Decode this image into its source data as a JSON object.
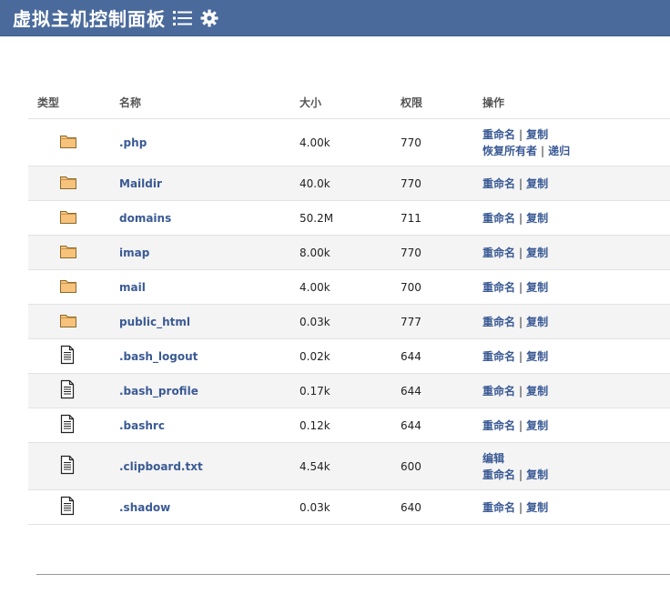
{
  "header": {
    "title": "虚拟主机控制面板",
    "menu_icon": "list-menu-icon",
    "settings_icon": "gear-icon",
    "bg_color": "#4a6a9c"
  },
  "table": {
    "columns": [
      "类型",
      "名称",
      "大小",
      "权限",
      "操作"
    ],
    "rows": [
      {
        "type": "folder",
        "name": ".php",
        "size": "4.00k",
        "perm": "770",
        "actions": [
          [
            "重命名",
            "复制"
          ],
          [
            "恢复所有者",
            "递归"
          ]
        ]
      },
      {
        "type": "folder",
        "name": "Maildir",
        "size": "40.0k",
        "perm": "770",
        "actions": [
          [
            "重命名",
            "复制"
          ]
        ]
      },
      {
        "type": "folder",
        "name": "domains",
        "size": "50.2M",
        "perm": "711",
        "actions": [
          [
            "重命名",
            "复制"
          ]
        ]
      },
      {
        "type": "folder",
        "name": "imap",
        "size": "8.00k",
        "perm": "770",
        "actions": [
          [
            "重命名",
            "复制"
          ]
        ]
      },
      {
        "type": "folder",
        "name": "mail",
        "size": "4.00k",
        "perm": "700",
        "actions": [
          [
            "重命名",
            "复制"
          ]
        ]
      },
      {
        "type": "folder",
        "name": "public_html",
        "size": "0.03k",
        "perm": "777",
        "actions": [
          [
            "重命名",
            "复制"
          ]
        ]
      },
      {
        "type": "file",
        "name": ".bash_logout",
        "size": "0.02k",
        "perm": "644",
        "actions": [
          [
            "重命名",
            "复制"
          ]
        ]
      },
      {
        "type": "file",
        "name": ".bash_profile",
        "size": "0.17k",
        "perm": "644",
        "actions": [
          [
            "重命名",
            "复制"
          ]
        ]
      },
      {
        "type": "file",
        "name": ".bashrc",
        "size": "0.12k",
        "perm": "644",
        "actions": [
          [
            "重命名",
            "复制"
          ]
        ]
      },
      {
        "type": "file",
        "name": ".clipboard.txt",
        "size": "4.54k",
        "perm": "600",
        "actions": [
          [
            "编辑"
          ],
          [
            "重命名",
            "复制"
          ]
        ]
      },
      {
        "type": "file",
        "name": ".shadow",
        "size": "0.03k",
        "perm": "640",
        "actions": [
          [
            "重命名",
            "复制"
          ]
        ]
      }
    ]
  },
  "colors": {
    "link": "#3a5a94",
    "folder": "#f6c27c",
    "row_alt": "#f4f4f4"
  }
}
